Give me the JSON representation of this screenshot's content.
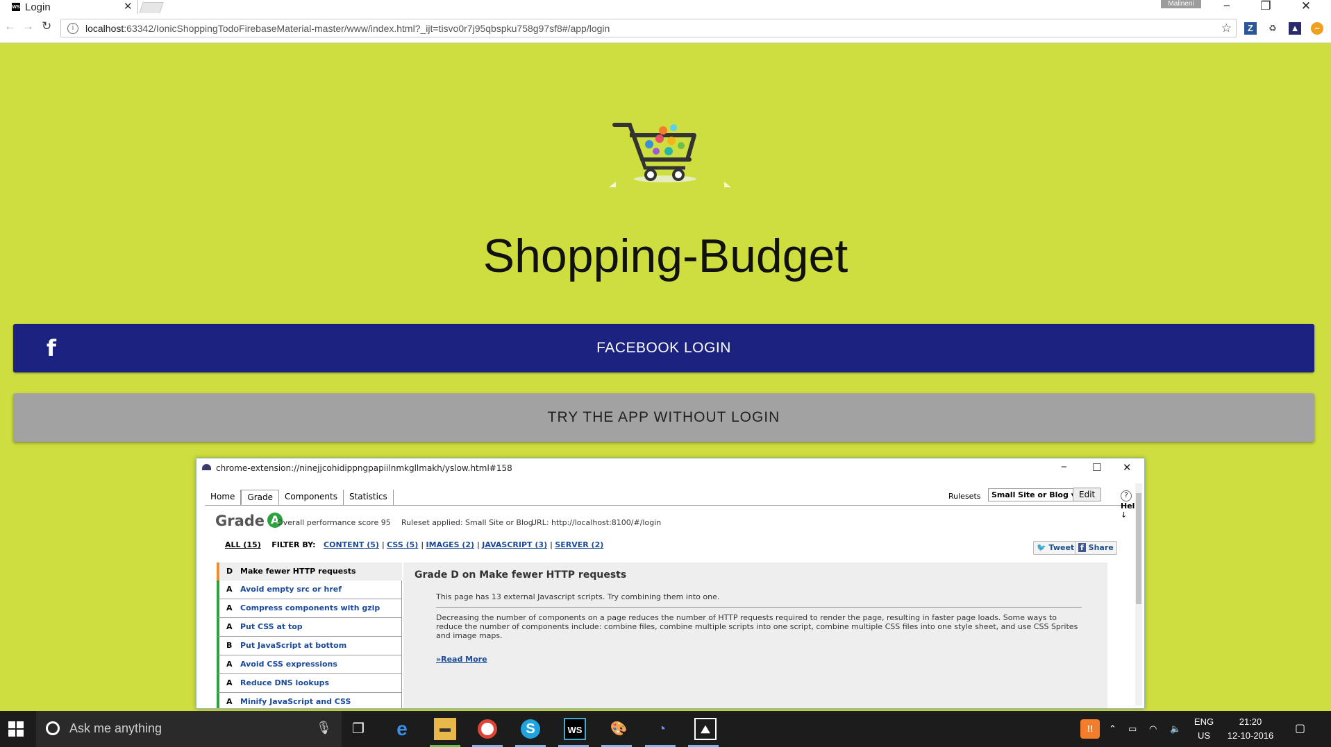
{
  "browser": {
    "tab_title": "Login",
    "tab_favicon": "WS",
    "profile_label": "Malineni",
    "url_host": "localhost",
    "url_rest": ":63342/IonicShoppingTodoFirebaseMaterial-master/www/index.html?_ijt=tisvo0r7j95qbspku758g97sf8#/app/login"
  },
  "app": {
    "title": "Shopping-Budget",
    "facebook_button": "FACEBOOK LOGIN",
    "facebook_icon_glyph": "f",
    "try_button": "TRY THE APP WITHOUT LOGIN"
  },
  "yslow": {
    "window_url": "chrome-extension://ninejjcohidippngpapiilnmkgllmakh/yslow.html#158",
    "tabs": [
      "Home",
      "Grade",
      "Components",
      "Statistics"
    ],
    "active_tab": "Grade",
    "rulesets_label": "Rulesets",
    "ruleset_value": "Small Site or Blog",
    "edit_label": "Edit",
    "help_label": "Help",
    "grade_label": "Grade",
    "grade_value": "A",
    "overall_score": "Overall performance score 95",
    "ruleset_applied": "Ruleset applied: Small Site or Blog",
    "url_info": "URL: http://localhost:8100/#/login",
    "filter": {
      "all": "ALL (15)",
      "label": "FILTER BY:",
      "content": "CONTENT (5)",
      "css": "CSS (5)",
      "images": "IMAGES (2)",
      "javascript": "JAVASCRIPT (3)",
      "server": "SERVER (2)"
    },
    "tweet_label": "Tweet",
    "share_label": "Share",
    "rules": [
      {
        "grade": "D",
        "name": "Make fewer HTTP requests"
      },
      {
        "grade": "A",
        "name": "Avoid empty src or href"
      },
      {
        "grade": "A",
        "name": "Compress components with gzip"
      },
      {
        "grade": "A",
        "name": "Put CSS at top"
      },
      {
        "grade": "B",
        "name": "Put JavaScript at bottom"
      },
      {
        "grade": "A",
        "name": "Avoid CSS expressions"
      },
      {
        "grade": "A",
        "name": "Reduce DNS lookups"
      },
      {
        "grade": "A",
        "name": "Minify JavaScript and CSS"
      }
    ],
    "detail": {
      "heading": "Grade D on Make fewer HTTP requests",
      "short": "This page has 13 external Javascript scripts. Try combining them into one.",
      "long": "Decreasing the number of components on a page reduces the number of HTTP requests required to render the page, resulting in faster page loads. Some ways to reduce the number of components include: combine files, combine multiple scripts into one script, combine multiple CSS files into one style sheet, and use CSS Sprites and image maps.",
      "read_more": "»Read More"
    }
  },
  "taskbar": {
    "search_placeholder": "Ask me anything",
    "language_top": "ENG",
    "language_bottom": "US",
    "time": "21:20",
    "date": "12-10-2016"
  },
  "colors": {
    "page_bg": "#cfde3f",
    "facebook_blue": "#1b2280",
    "try_gray": "#a2a2a2",
    "grade_green": "#2aa33f",
    "grade_orange": "#f28c28"
  }
}
